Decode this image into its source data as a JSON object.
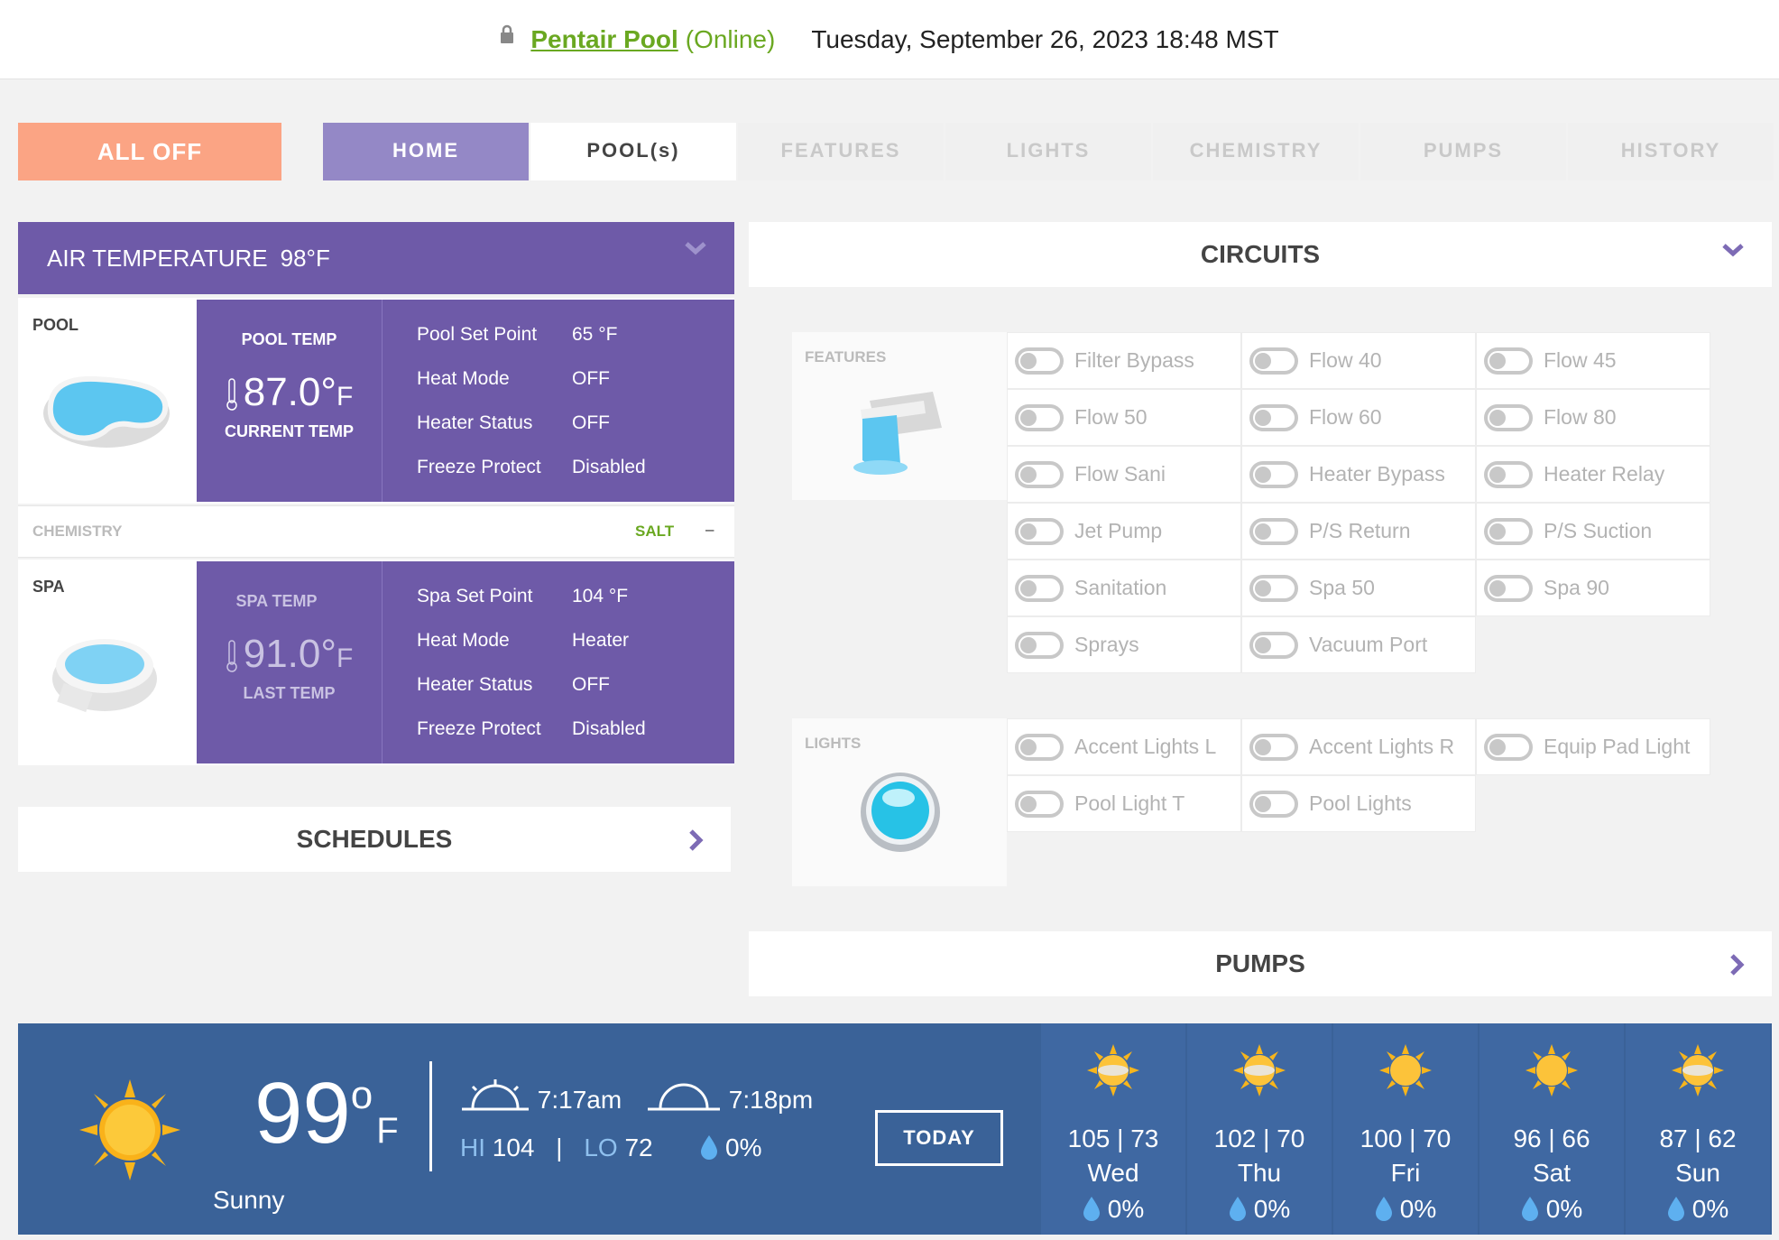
{
  "header": {
    "pool_name": "Pentair Pool",
    "status": "(Online)",
    "datetime": "Tuesday, September 26, 2023 18:48 MST"
  },
  "nav": {
    "all_off": "ALL OFF",
    "tabs": [
      "HOME",
      "POOL(s)",
      "FEATURES",
      "LIGHTS",
      "CHEMISTRY",
      "PUMPS",
      "HISTORY"
    ],
    "active": "HOME"
  },
  "air": {
    "label": "AIR TEMPERATURE",
    "value": "98°F"
  },
  "pool": {
    "label": "POOL",
    "temp_label": "POOL TEMP",
    "temp_value": "87.0°",
    "temp_unit": "F",
    "temp_sub": "CURRENT TEMP",
    "rows": [
      {
        "k": "Pool Set Point",
        "v": "65  °F"
      },
      {
        "k": "Heat Mode",
        "v": "OFF"
      },
      {
        "k": "Heater Status",
        "v": "OFF"
      },
      {
        "k": "Freeze Protect",
        "v": "Disabled"
      }
    ]
  },
  "chemistry": {
    "label": "CHEMISTRY",
    "salt": "SALT",
    "salt_value": "–"
  },
  "spa": {
    "label": "SPA",
    "temp_label": "SPA TEMP",
    "temp_value": "91.0°",
    "temp_unit": "F",
    "temp_sub": "LAST TEMP",
    "rows": [
      {
        "k": "Spa Set Point",
        "v": "104  °F"
      },
      {
        "k": "Heat Mode",
        "v": "Heater"
      },
      {
        "k": "Heater Status",
        "v": "OFF"
      },
      {
        "k": "Freeze Protect",
        "v": "Disabled"
      }
    ]
  },
  "schedules": {
    "label": "SCHEDULES"
  },
  "circuits": {
    "title": "CIRCUITS",
    "features_label": "FEATURES",
    "features": [
      "Filter Bypass",
      "Flow 40",
      "Flow 45",
      "Flow 50",
      "Flow 60",
      "Flow 80",
      "Flow Sani",
      "Heater Bypass",
      "Heater Relay",
      "Jet Pump",
      "P/S Return",
      "P/S Suction",
      "Sanitation",
      "Spa 50",
      "Spa 90",
      "Sprays",
      "Vacuum Port"
    ],
    "lights_label": "LIGHTS",
    "lights": [
      "Accent Lights L",
      "Accent Lights R",
      "Equip Pad Light",
      "Pool Light T",
      "Pool Lights"
    ]
  },
  "pumps": {
    "label": "PUMPS"
  },
  "weather": {
    "temp": "99",
    "unit": "F",
    "condition": "Sunny",
    "sunrise": "7:17am",
    "sunset": "7:18pm",
    "hi_label": "HI",
    "hi": "104",
    "lo_label": "LO",
    "lo": "72",
    "precip": "0%",
    "today_button": "TODAY",
    "forecast": [
      {
        "hl": "105 | 73",
        "day": "Wed",
        "precip": "0%",
        "icon": "partly-sunny-icon"
      },
      {
        "hl": "102 | 70",
        "day": "Thu",
        "precip": "0%",
        "icon": "partly-sunny-icon"
      },
      {
        "hl": "100 | 70",
        "day": "Fri",
        "precip": "0%",
        "icon": "sun-icon"
      },
      {
        "hl": "96 | 66",
        "day": "Sat",
        "precip": "0%",
        "icon": "sun-icon"
      },
      {
        "hl": "87 | 62",
        "day": "Sun",
        "precip": "0%",
        "icon": "partly-sunny-icon"
      }
    ]
  },
  "colors": {
    "accent": "#6e5aa8",
    "all_off": "#fba484",
    "online": "#6aa821",
    "weather_bg": "#3a6298"
  }
}
